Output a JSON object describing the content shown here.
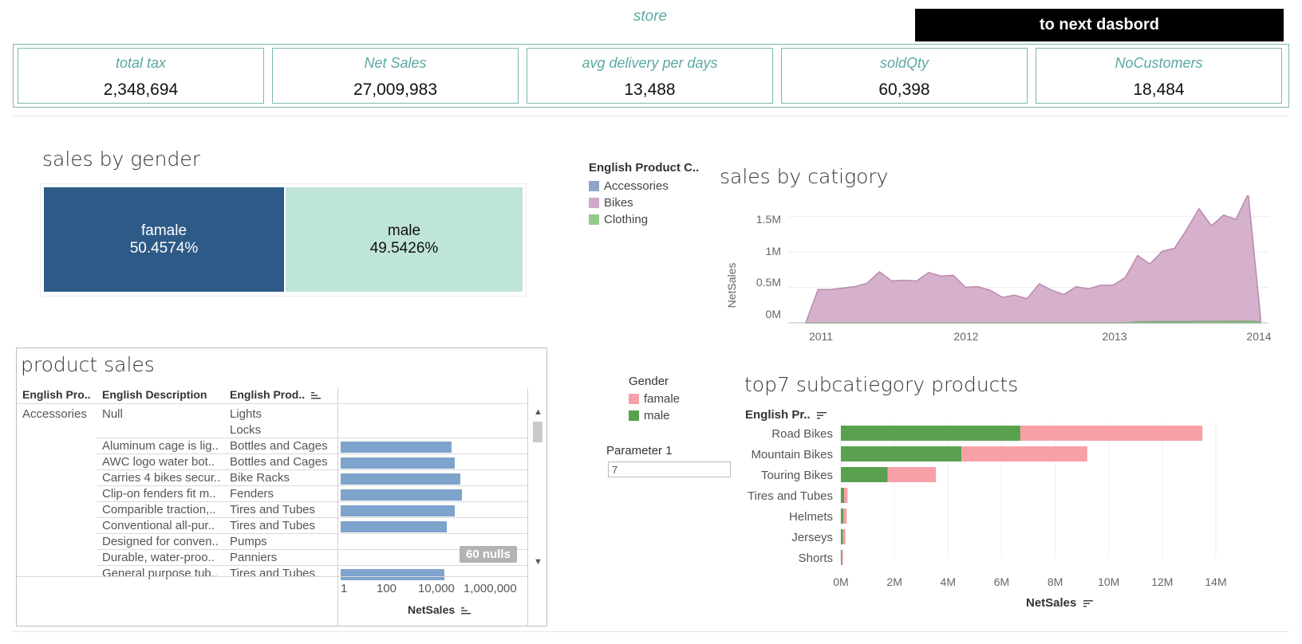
{
  "header": {
    "title": "store",
    "next_button": "to next dasbord"
  },
  "kpis": [
    {
      "label": "total tax",
      "value": "2,348,694"
    },
    {
      "label": "Net Sales",
      "value": "27,009,983"
    },
    {
      "label": "avg delivery per days",
      "value": "13,488"
    },
    {
      "label": "soldQty",
      "value": "60,398"
    },
    {
      "label": "NoCustomers",
      "value": "18,484"
    }
  ],
  "gender_panel": {
    "title": "sales by gender",
    "cells": [
      {
        "label": "famale",
        "pct": "50.4574%",
        "share": 50.4574,
        "color": "#2d5a87",
        "text_color": "#ffffff"
      },
      {
        "label": "male",
        "pct": "49.5426%",
        "share": 49.5426,
        "color": "#bfe4d9",
        "text_color": "#111111"
      }
    ]
  },
  "category_legend": {
    "title": "English Product C..",
    "items": [
      {
        "label": "Accessories",
        "color": "#8ea6c9"
      },
      {
        "label": "Bikes",
        "color": "#d2a8c8"
      },
      {
        "label": "Clothing",
        "color": "#92c98c"
      }
    ]
  },
  "category_chart": {
    "title": "sales by catigory",
    "ylabel": "NetSales",
    "yticks": [
      "1.5M",
      "1M",
      "0.5M",
      "0M"
    ],
    "xticks": [
      "2011",
      "2012",
      "2013",
      "2014"
    ]
  },
  "gender_legend": {
    "title": "Gender",
    "items": [
      {
        "label": "famale",
        "color": "#f7a0a8"
      },
      {
        "label": "male",
        "color": "#59a14f"
      }
    ]
  },
  "parameter": {
    "label": "Parameter 1",
    "value": "7"
  },
  "top7": {
    "title": "top7 subcatiegory products",
    "y_header": "English Pr..",
    "xlabel": "NetSales",
    "xticks": [
      "0M",
      "2M",
      "4M",
      "6M",
      "8M",
      "10M",
      "12M",
      "14M"
    ]
  },
  "product_sales": {
    "title": "product sales",
    "headers": [
      "English Pro..",
      "English Description",
      "English Prod..",
      ""
    ],
    "category": "Accessories",
    "rows": [
      {
        "desc": "Null",
        "prod": "Lights",
        "value": null
      },
      {
        "desc": "",
        "prod": "Locks",
        "value": null
      },
      {
        "desc": "Aluminum cage is lig..",
        "prod": "Bottles and Cages",
        "value": 7500
      },
      {
        "desc": "AWC logo water bot..",
        "prod": "Bottles and Cages",
        "value": 9500
      },
      {
        "desc": "Carries 4 bikes secur..",
        "prod": "Bike Racks",
        "value": 15000
      },
      {
        "desc": "Clip-on fenders fit m..",
        "prod": "Fenders",
        "value": 17000
      },
      {
        "desc": "Comparible traction,..",
        "prod": "Tires and Tubes",
        "value": 9500
      },
      {
        "desc": "Conventional all-pur..",
        "prod": "Tires and Tubes",
        "value": 5000
      },
      {
        "desc": "Designed for conven..",
        "prod": "Pumps",
        "value": null
      },
      {
        "desc": "Durable, water-proo..",
        "prod": "Panniers",
        "value": null
      },
      {
        "desc": "General purpose tub..",
        "prod": "Tires and Tubes",
        "value": 4200
      }
    ],
    "nulls_badge": "60 nulls",
    "xticks": [
      "1",
      "100",
      "10,000",
      "1,000,000"
    ],
    "xlabel": "NetSales"
  },
  "chart_data": [
    {
      "type": "area",
      "title": "sales by catigory",
      "ylabel": "NetSales",
      "ylim": [
        0,
        1800000
      ],
      "xlim": [
        "2010-12",
        "2014-01"
      ],
      "x": [
        "2010-12",
        "2011-01",
        "2011-02",
        "2011-03",
        "2011-04",
        "2011-05",
        "2011-06",
        "2011-07",
        "2011-08",
        "2011-09",
        "2011-10",
        "2011-11",
        "2011-12",
        "2012-01",
        "2012-02",
        "2012-03",
        "2012-04",
        "2012-05",
        "2012-06",
        "2012-07",
        "2012-08",
        "2012-09",
        "2012-10",
        "2012-11",
        "2012-12",
        "2013-01",
        "2013-02",
        "2013-03",
        "2013-04",
        "2013-05",
        "2013-06",
        "2013-07",
        "2013-08",
        "2013-09",
        "2013-10",
        "2013-11",
        "2013-12",
        "2014-01"
      ],
      "series": [
        {
          "name": "Bikes",
          "values": [
            0,
            470000,
            470000,
            490000,
            510000,
            560000,
            720000,
            590000,
            600000,
            590000,
            710000,
            660000,
            670000,
            500000,
            510000,
            460000,
            360000,
            390000,
            340000,
            550000,
            460000,
            400000,
            510000,
            480000,
            530000,
            530000,
            640000,
            950000,
            830000,
            1010000,
            1050000,
            1320000,
            1610000,
            1370000,
            1520000,
            1460000,
            1820000,
            80000
          ]
        },
        {
          "name": "Accessories",
          "values": [
            0,
            0,
            0,
            0,
            0,
            0,
            0,
            0,
            0,
            0,
            0,
            0,
            0,
            0,
            0,
            0,
            0,
            0,
            0,
            0,
            0,
            0,
            0,
            0,
            0,
            0,
            0,
            20000,
            25000,
            26000,
            27000,
            28000,
            29000,
            30000,
            31000,
            32000,
            33000,
            20000
          ]
        },
        {
          "name": "Clothing",
          "values": [
            0,
            0,
            0,
            0,
            0,
            0,
            0,
            0,
            0,
            0,
            0,
            0,
            0,
            0,
            0,
            0,
            0,
            0,
            0,
            0,
            0,
            0,
            0,
            0,
            0,
            0,
            0,
            12000,
            14000,
            15000,
            16000,
            16000,
            17000,
            17000,
            18000,
            18000,
            19000,
            10000
          ]
        }
      ]
    },
    {
      "type": "bar",
      "title": "top7 subcatiegory products",
      "xlabel": "NetSales",
      "xlim": [
        0,
        14000000
      ],
      "categories": [
        "Road Bikes",
        "Mountain Bikes",
        "Touring Bikes",
        "Tires and Tubes",
        "Helmets",
        "Jerseys",
        "Shorts"
      ],
      "series": [
        {
          "name": "male",
          "values": [
            6700000,
            4500000,
            1750000,
            120000,
            100000,
            80000,
            40000
          ]
        },
        {
          "name": "famale",
          "values": [
            6800000,
            4700000,
            1800000,
            130000,
            120000,
            90000,
            40000
          ]
        }
      ]
    },
    {
      "type": "bar",
      "title": "product sales",
      "xlabel": "NetSales",
      "scale": "log",
      "categories": [
        "Aluminum cage is lig..",
        "AWC logo water bot..",
        "Carries 4 bikes secur..",
        "Clip-on fenders fit m..",
        "Comparible traction,..",
        "Conventional all-pur..",
        "General purpose tub.."
      ],
      "values": [
        7500,
        9500,
        15000,
        17000,
        9500,
        5000,
        4200
      ]
    }
  ]
}
